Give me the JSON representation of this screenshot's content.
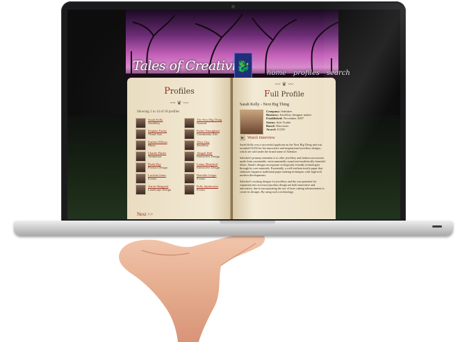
{
  "site": {
    "logo": "Tales of Creativity",
    "nav": [
      "home",
      "profiles",
      "search"
    ],
    "badge_icon": "dragon-icon"
  },
  "profiles_page": {
    "title_initial": "P",
    "title_rest": "rofiles",
    "showing": "Showing 1 to 14 of 18 profiles",
    "items": [
      {
        "name": "Sarah Kelly",
        "role": "Jewellery"
      },
      {
        "name": "The Next Big Thing",
        "role": "General"
      },
      {
        "name": "Stephen Farley",
        "role": "Visual Arts"
      },
      {
        "name": "Esther Fannigham",
        "role": "Community Arts"
      },
      {
        "name": "Kathrin Wilson",
        "role": "Music"
      },
      {
        "name": "Alice Guy",
        "role": "Jewellery"
      },
      {
        "name": "Charlie Pinder",
        "role": "Animation"
      },
      {
        "name": "Abigail Hall",
        "role": "Interactive Design"
      },
      {
        "name": "Paula Day",
        "role": "Product Design"
      },
      {
        "name": "Lenny Mansford",
        "role": "Interactive Design"
      },
      {
        "name": "Lucinda Jones",
        "role": "Events"
      },
      {
        "name": "Daniella Geiger",
        "role": "Events"
      },
      {
        "name": "Aaron Sheppard",
        "role": "Landscape Design"
      },
      {
        "name": "Polly Spinkwater",
        "role": "Events"
      }
    ],
    "next": "Next >>"
  },
  "full_profile": {
    "title_initial": "F",
    "title_rest": "ull Profile",
    "name": "Sarah Kelly - Next Big Thing",
    "details": [
      {
        "label": "Company:",
        "value": "Saleskee"
      },
      {
        "label": "Business:",
        "value": "Jewellery designer maker"
      },
      {
        "label": "Established:",
        "value": "November 2007"
      },
      {
        "label": "Status:",
        "value": "Sole Trader"
      },
      {
        "label": "Based:",
        "value": "Worcester"
      },
      {
        "label": "Award:",
        "value": "£1250"
      }
    ],
    "watch": "Watch Interview",
    "paragraphs": [
      "Sarah Kelly was a successful applicant on the Next Big Thing and was awarded £1250 for her innovative and inspirational jewellery designs, which are sold under the brand name of Saleskee.",
      "Saleskee's primary intention is to offer jewellery and fashion accessories made from sustainable, environmentally sound and aesthetically beautiful fibres. Sarah's designs incorporate ecologically friendly technologies through its core materials. Essentially, a well-resilient textile paper that embraces Japanese traditional paper making techniques with high-tech modern developments.",
      "Saleskee's exciting designs for jewellery and the vast potential for expansion into accessory/product design are both innovative and innovative, due to incorporating the use of laser cutting advancements to create its designs. By using such a technology,"
    ]
  }
}
